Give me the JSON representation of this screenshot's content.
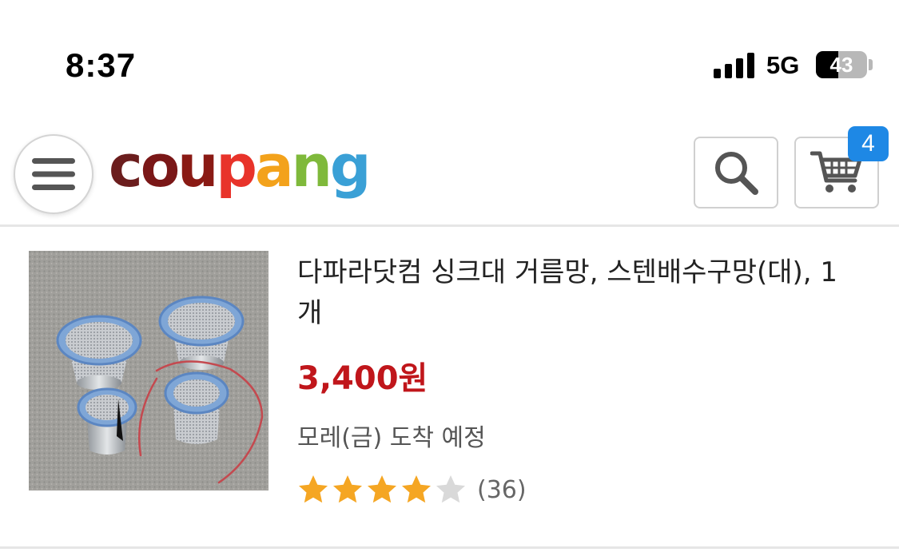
{
  "status_bar": {
    "time": "8:37",
    "network": "5G",
    "battery_level": "43",
    "battery_fraction": 0.43
  },
  "header": {
    "menu_icon": "hamburger-icon",
    "logo": {
      "letters": [
        "c",
        "o",
        "u",
        "p",
        "a",
        "n",
        "g"
      ],
      "colors": [
        "#6b1d1d",
        "#7a1717",
        "#8a1a14",
        "#e8332a",
        "#f3a21b",
        "#7fb93b",
        "#3aa0d6"
      ]
    },
    "search_icon": "search-icon",
    "cart_icon": "cart-icon",
    "cart_count": "4"
  },
  "product": {
    "title": "다파라닷컴 싱크대 거름망, 스텐배수구망(대), 1개",
    "price": "3,400원",
    "delivery": "모레(금) 도착 예정",
    "rating": 4,
    "rating_max": 5,
    "review_count": "(36)"
  },
  "colors": {
    "price": "#c0161b",
    "star_filled": "#f5a623",
    "star_empty": "#d9d9d9",
    "badge": "#1e88e5"
  }
}
